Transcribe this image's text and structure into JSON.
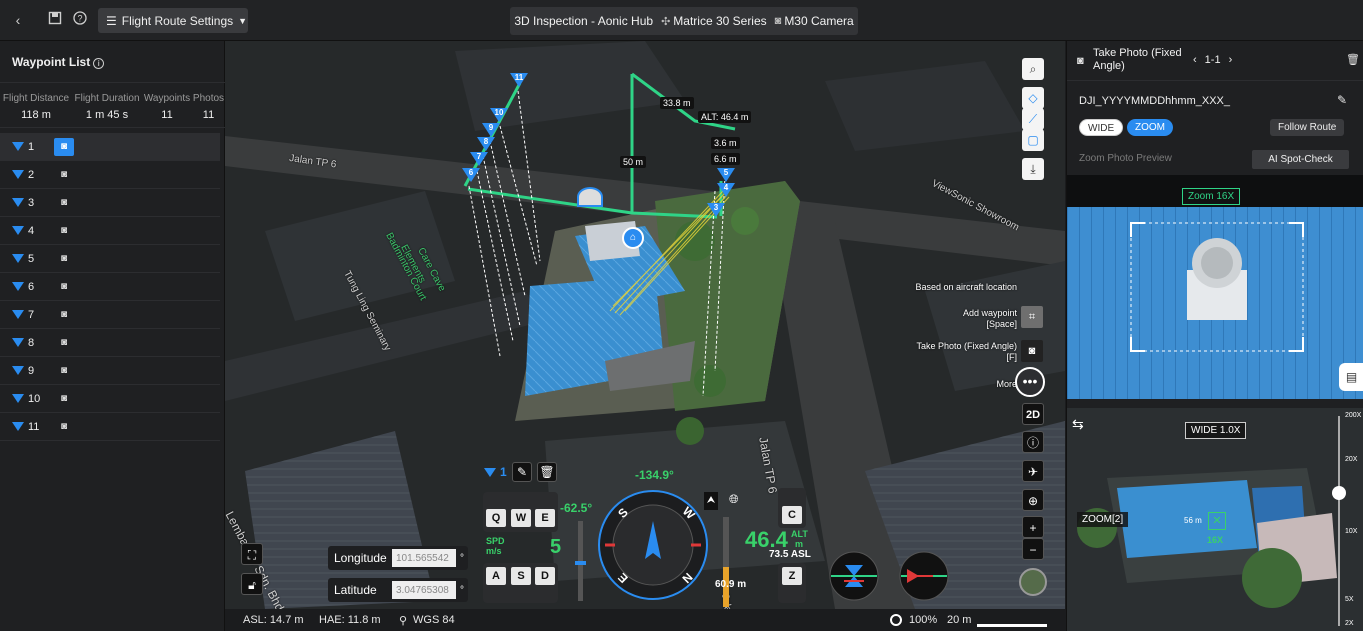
{
  "topbar": {
    "route_settings_label": "Flight Route Settings",
    "mission_name": "3D Inspection - Aonic Hub",
    "aircraft": "Matrice 30 Series",
    "camera": "M30 Camera"
  },
  "waypoint_list": {
    "title": "Waypoint List",
    "stats": [
      {
        "label": "Flight Distance",
        "value": "118 m"
      },
      {
        "label": "Flight Duration",
        "value": "1 m 45 s"
      },
      {
        "label": "Waypoints",
        "value": "11"
      },
      {
        "label": "Photos",
        "value": "11"
      }
    ],
    "items": [
      "1",
      "2",
      "3",
      "4",
      "5",
      "6",
      "7",
      "8",
      "9",
      "10",
      "11"
    ],
    "selected": "1"
  },
  "map": {
    "labels": {
      "road_1": "Jalan TP 6",
      "road_2": "Jalan TP 6",
      "viewsonic": "ViewSonic Showroom",
      "cave": "Care Cave",
      "elements": "Elements",
      "badminton": "Badminton Court",
      "tung_ling": "Tung Ling Seminary",
      "lembat": "Lembat Sri Sdn. Bhd",
      "bottom_road": "Jalan"
    },
    "distances": {
      "top": "33.8 m",
      "alt": "ALT: 46.4 m",
      "d36": "3.6 m",
      "d66": "6.6 m",
      "vertical": "50 m"
    },
    "waypoint_markers": [
      "11",
      "10",
      "9",
      "8",
      "7",
      "6",
      "5",
      "4",
      "3"
    ],
    "hints": {
      "based_on": "Based on aircraft location",
      "add_waypoint": "Add waypoint",
      "add_key": "[Space]",
      "take_photo": "Take Photo (Fixed Angle)",
      "take_key": "[F]",
      "more": "More"
    },
    "tools": {
      "view_2d": "2D",
      "zoom_in": "+",
      "zoom_out": "−"
    }
  },
  "hud": {
    "selected_waypoint": "1",
    "heading": "-134.9°",
    "gimbal_pitch": "-62.5°",
    "speed": "5",
    "speed_label": "SPD",
    "speed_unit": "m/s",
    "keys_top": [
      "Q",
      "W",
      "E"
    ],
    "keys_bottom": [
      "A",
      "S",
      "D"
    ],
    "altitude": "46.4",
    "alt_label": "ALT",
    "alt_unit": "m",
    "asl": "73.5 ASL",
    "height_below": "60.9 m",
    "key_c": "C",
    "key_z": "Z",
    "compass": {
      "N": "N",
      "E": "E",
      "S": "S",
      "W": "W"
    },
    "longitude_label": "Longitude",
    "longitude_value": "101.565542",
    "latitude_label": "Latitude",
    "latitude_value": "3.04765308",
    "degree": "°"
  },
  "statusbar": {
    "asl": "ASL: 14.7 m",
    "hae": "HAE: 11.8 m",
    "datum": "WGS 84",
    "opacity": "100%",
    "scale": "20 m"
  },
  "action_panel": {
    "title": "Take Photo (Fixed Angle)",
    "nav": "1-1",
    "file_name": "DJI_YYYYMMDDhhmm_XXX_",
    "lens_wide": "WIDE",
    "lens_zoom": "ZOOM",
    "follow_route": "Follow Route",
    "preview_label": "Zoom Photo Preview",
    "ai_spot_check": "AI Spot-Check",
    "zoom_tag": "Zoom 16X",
    "wide_tag": "WIDE 1.0X",
    "zoom2_tag": "ZOOM[2]",
    "target_distance": "56 m",
    "target_zoom": "16X",
    "zoom_scale": [
      "200X",
      "20X",
      "10X",
      "5X",
      "2X"
    ]
  },
  "colors": {
    "accent": "#2a8cf0",
    "route_green": "#2fd487",
    "hud_green": "#39d16a"
  }
}
